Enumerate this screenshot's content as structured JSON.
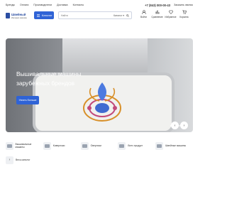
{
  "topnav": {
    "links": [
      "Бренды",
      "Оплата",
      "Производители",
      "Доставка",
      "Контакты"
    ],
    "phone": "+7 (843) 000-00-43",
    "callback": "Заказать звонок"
  },
  "logo": {
    "title": "Швейный",
    "subtitle": "Интернет-магазин"
  },
  "catalog_button": "Каталог",
  "search": {
    "placeholder": "Найти",
    "category": "Каталог ▾"
  },
  "header_icons": [
    {
      "label": "Войти",
      "icon": "user-icon"
    },
    {
      "label": "Сравнение",
      "icon": "compare-icon"
    },
    {
      "label": "Избранное",
      "icon": "heart-icon"
    },
    {
      "label": "Корзина",
      "icon": "cart-icon"
    }
  ],
  "banner": {
    "title": "Вышивальные машины зарубежных брендов",
    "button": "Узнать больше",
    "slides": 4,
    "active_slide": 1
  },
  "categories": [
    "Вышивальные машины",
    "Коверлоки",
    "Оверлоки",
    "Витч продукт",
    "Швейные машины"
  ],
  "all_categories": "Весь каталог",
  "colors": {
    "accent": "#2f63d6",
    "brand": "#2b4ea2"
  }
}
